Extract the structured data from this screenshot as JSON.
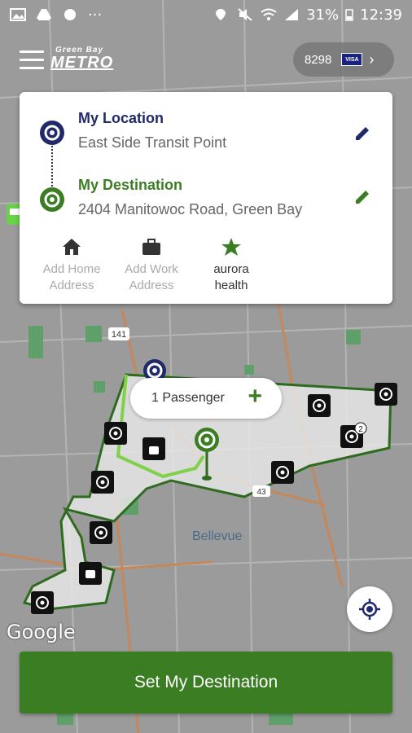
{
  "status_bar": {
    "battery": "31%",
    "time": "12:39",
    "dots": "···"
  },
  "header": {
    "logo_small": "Green Bay",
    "logo_big": "METRO",
    "card_last4": "8298",
    "card_brand": "VISA"
  },
  "route": {
    "origin_title": "My Location",
    "origin_value": "East Side Transit Point",
    "destination_title": "My Destination",
    "destination_value": "2404 Manitowoc Road, Green Bay"
  },
  "shortcuts": [
    {
      "label_line1": "Add Home",
      "label_line2": "Address",
      "icon": "home-icon"
    },
    {
      "label_line1": "Add Work",
      "label_line2": "Address",
      "icon": "briefcase-icon"
    },
    {
      "label_line1": "aurora",
      "label_line2": "health",
      "icon": "star-icon"
    }
  ],
  "passenger": {
    "label": "1 Passenger",
    "plus": "+"
  },
  "map": {
    "place_label": "Bellevue",
    "highway_141": "141",
    "highway_43": "43",
    "stop_cluster_count": "2",
    "attribution": "Google"
  },
  "cta": {
    "label": "Set My Destination"
  },
  "colors": {
    "navy": "#1f2a6b",
    "green": "#3b7d23",
    "map_bg": "#9a9a9a"
  }
}
